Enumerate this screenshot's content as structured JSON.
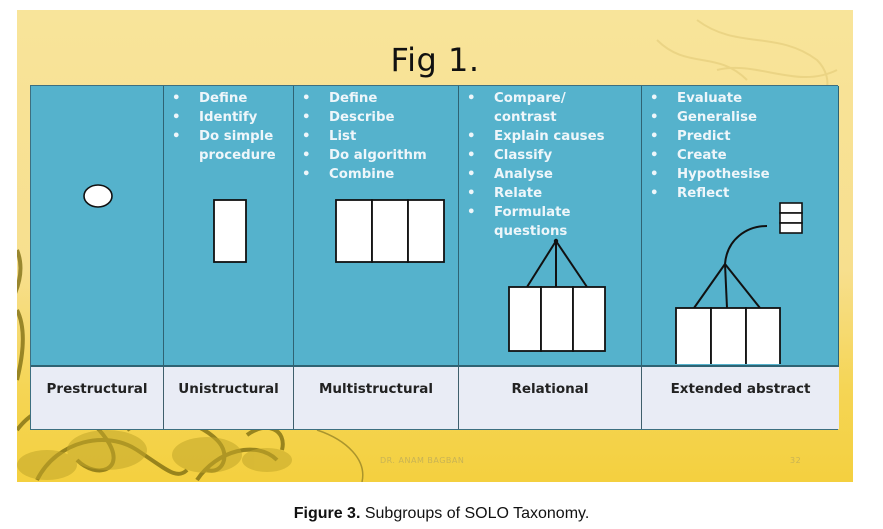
{
  "slide": {
    "title": "Fig 1.",
    "footer": {
      "date": "",
      "author": "DR. ANAM BAGBAN",
      "page_number": "32"
    },
    "colors": {
      "background_top": "#f8e49a",
      "background_bottom": "#f4d03f",
      "column_fill": "#55b2cc",
      "label_fill": "#e9ecf5",
      "verb_text": "#eef6fa"
    }
  },
  "taxonomy": {
    "levels": [
      {
        "name": "Prestructural",
        "verbs": [],
        "icon": "single-circle"
      },
      {
        "name": "Unistructural",
        "verbs": [
          "Define",
          "Identify",
          "Do simple",
          "procedure"
        ],
        "icon": "single-block"
      },
      {
        "name": "Multistructural",
        "verbs": [
          "Define",
          "Describe",
          "List",
          "Do algorithm",
          "Combine"
        ],
        "icon": "three-blocks"
      },
      {
        "name": "Relational",
        "verbs": [
          "Compare/",
          "contrast",
          "Explain causes",
          "Classify",
          "Analyse",
          "Relate",
          "Formulate",
          "questions"
        ],
        "icon": "three-blocks-connected"
      },
      {
        "name": "Extended abstract",
        "verbs": [
          "Evaluate",
          "Generalise",
          "Predict",
          "Create",
          "Hypothesise",
          "Reflect"
        ],
        "icon": "three-blocks-connected-extended"
      }
    ]
  },
  "caption": {
    "label": "Figure 3.",
    "text": " Subgroups of SOLO Taxonomy."
  }
}
